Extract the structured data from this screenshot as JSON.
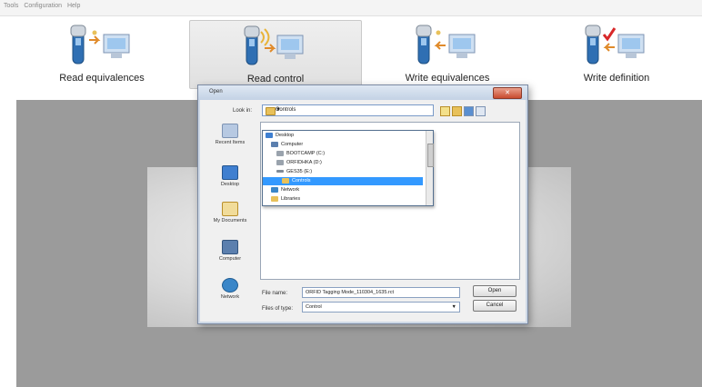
{
  "menu": [
    "Tools",
    "Configuration",
    "Help"
  ],
  "toolbar": {
    "buttons": [
      {
        "label": "Read equivalences",
        "icon": "reader-to-pc-icon"
      },
      {
        "label": "Read control",
        "icon": "reader-signal-pc-icon"
      },
      {
        "label": "Write equivalences",
        "icon": "pc-to-reader-icon"
      },
      {
        "label": "Write definition",
        "icon": "check-to-reader-icon"
      }
    ],
    "active_index": 1
  },
  "dialog": {
    "title": "Open",
    "look_in_label": "Look in:",
    "look_in_value": "Controls",
    "places": [
      "Recent Items",
      "Desktop",
      "My Documents",
      "Computer",
      "Network"
    ],
    "dropdown": [
      "Desktop",
      "Computer",
      "BOOTCAMP (C:)",
      "ORFIDHKA (D:)",
      "GES35 (E:)",
      "Controls",
      "Network",
      "Libraries"
    ],
    "dropdown_selected": 5,
    "file_name_label": "File name:",
    "file_name_value": "ORFID Tagging Mode_110304_1635.rct",
    "file_type_label": "Files of type:",
    "file_type_value": "Control",
    "open_label": "Open",
    "cancel_label": "Cancel"
  },
  "colors": {
    "accent": "#3399ff",
    "backdrop": "#9b9b9b",
    "close": "#c84a2f"
  }
}
